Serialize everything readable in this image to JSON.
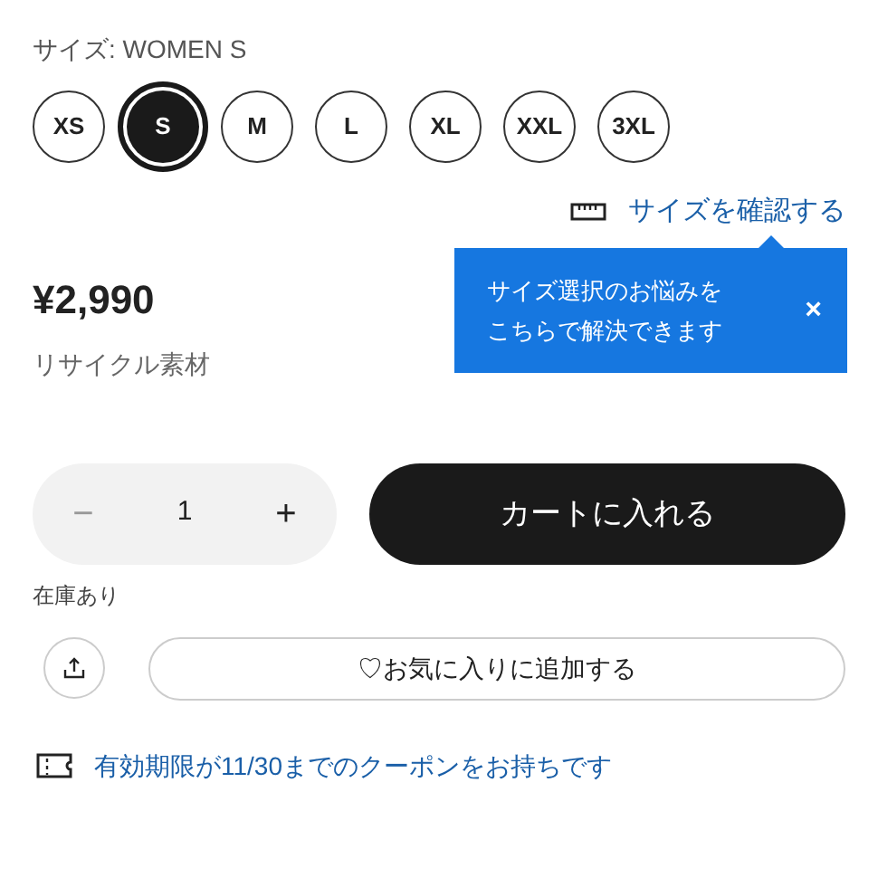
{
  "size_label": "サイズ: WOMEN S",
  "sizes": [
    {
      "label": "XS",
      "selected": false
    },
    {
      "label": "S",
      "selected": true
    },
    {
      "label": "M",
      "selected": false
    },
    {
      "label": "L",
      "selected": false
    },
    {
      "label": "XL",
      "selected": false
    },
    {
      "label": "XXL",
      "selected": false
    },
    {
      "label": "3XL",
      "selected": false
    }
  ],
  "size_guide_link": "サイズを確認する",
  "tooltip": {
    "lines": [
      "サイズ選択のお悩みを",
      "こちらで解決できます"
    ],
    "close": "×"
  },
  "price": "¥2,990",
  "material": "リサイクル素材",
  "quantity": {
    "minus": "−",
    "value": "1",
    "plus": "+"
  },
  "add_to_cart": "カートに入れる",
  "stock": "在庫あり",
  "favorite_button": "♡お気に入りに追加する",
  "coupon_link": "有効期限が11/30までのクーポンをお持ちです"
}
